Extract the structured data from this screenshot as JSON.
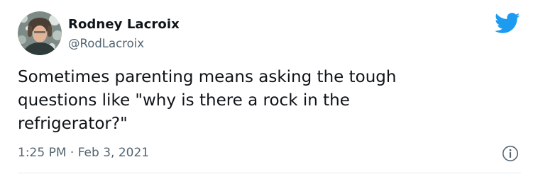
{
  "tweet": {
    "author": {
      "display_name": "Rodney Lacroix",
      "handle": "@RodLacroix",
      "avatar_icon": "user-avatar-photo"
    },
    "text_lines": [
      "Sometimes parenting means asking the tough",
      "questions like \"why is there a rock in the",
      "refrigerator?\""
    ],
    "timestamp": "1:25 PM · Feb 3, 2021",
    "brand_icon": "twitter-bird-icon",
    "info_icon": "info-icon"
  },
  "colors": {
    "brand": "#1d9bf0",
    "text_primary": "#0f1419",
    "text_secondary": "#536471",
    "divider": "#e1e8ed"
  }
}
